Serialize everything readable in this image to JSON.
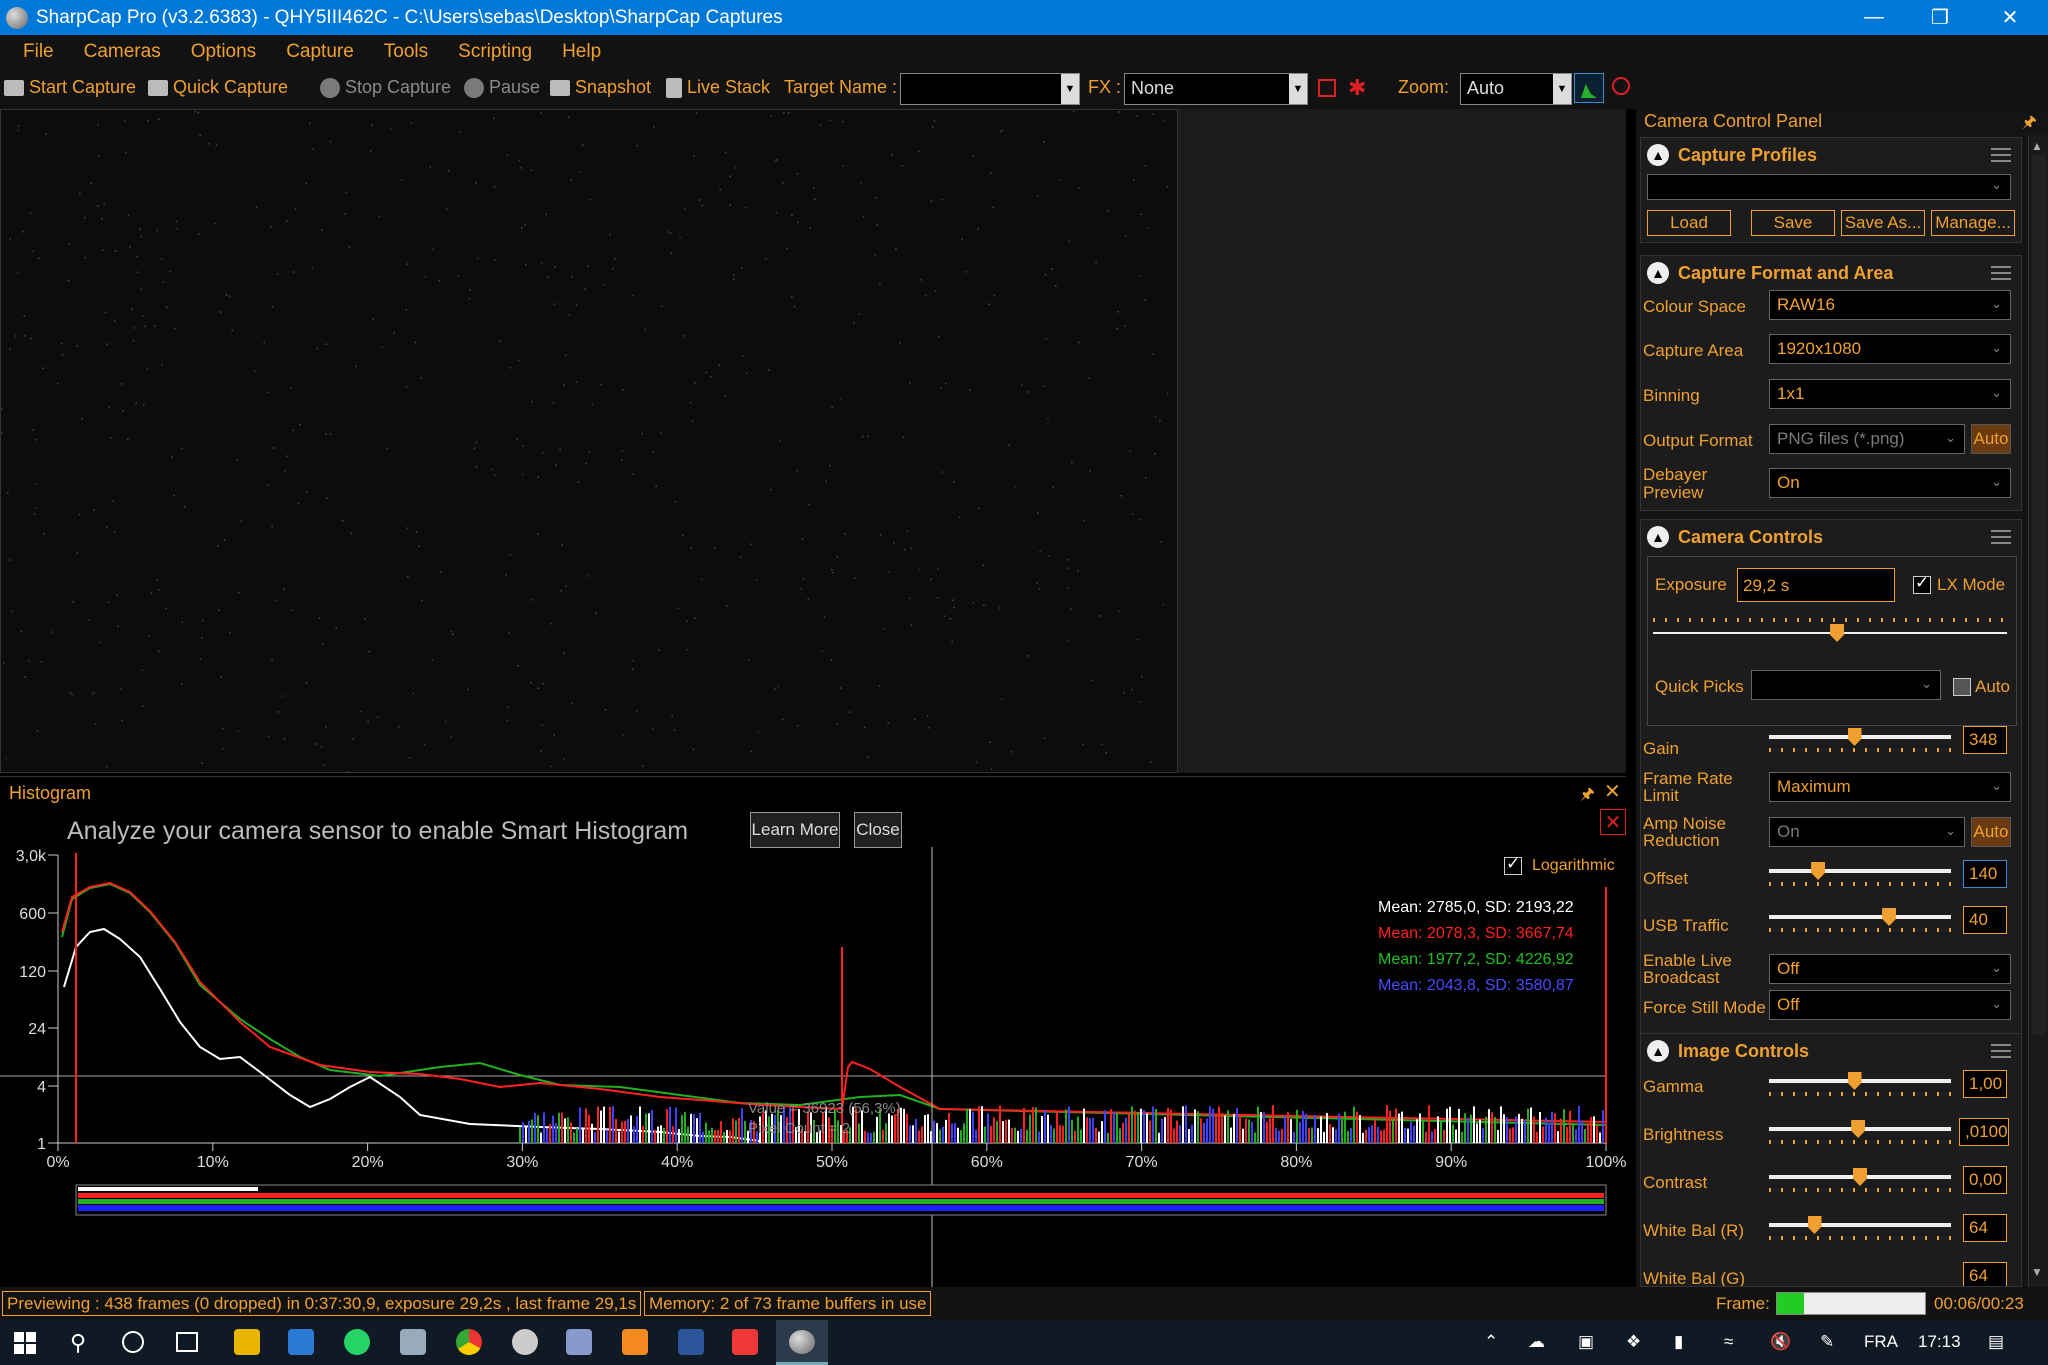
{
  "window": {
    "title": "SharpCap Pro (v3.2.6383) - QHY5III462C - C:\\Users\\sebas\\Desktop\\SharpCap Captures"
  },
  "menu": [
    "File",
    "Cameras",
    "Options",
    "Capture",
    "Tools",
    "Scripting",
    "Help"
  ],
  "toolbar": {
    "start_capture": "Start Capture",
    "quick_capture": "Quick Capture",
    "stop_capture": "Stop Capture",
    "pause": "Pause",
    "snapshot": "Snapshot",
    "live_stack": "Live Stack",
    "target_name_label": "Target Name :",
    "target_name_value": "",
    "fx_label": "FX :",
    "fx_value": "None",
    "zoom_label": "Zoom:",
    "zoom_value": "Auto"
  },
  "histogram": {
    "title": "Histogram",
    "banner": "Analyze your camera sensor to enable Smart Histogram",
    "learn_more": "Learn More",
    "close": "Close",
    "logarithmic_label": "Logarithmic",
    "logarithmic_checked": true,
    "stats": [
      {
        "text": "Mean: 2785,0, SD: 2193,22",
        "color": "#ffffff"
      },
      {
        "text": "Mean: 2078,3, SD: 3667,74",
        "color": "#ff2020"
      },
      {
        "text": "Mean: 1977,2, SD: 4226,92",
        "color": "#20c020"
      },
      {
        "text": "Mean: 2043,8, SD: 3580,87",
        "color": "#4040ff"
      }
    ],
    "cursor_value": "Value = 36923 (56,3%)",
    "cursor_pixel_count": "Pixel Count = 2",
    "y_ticks": [
      "3,0k",
      "600",
      "120",
      "24",
      "4",
      "1"
    ],
    "x_ticks": [
      "0%",
      "10%",
      "20%",
      "30%",
      "40%",
      "50%",
      "60%",
      "70%",
      "80%",
      "90%",
      "100%"
    ]
  },
  "status": {
    "previewing": "Previewing : 438 frames (0 dropped) in 0:37:30,9, exposure 29,2s , last frame 29,1s",
    "memory": "Memory: 2 of 73 frame buffers in use",
    "frame_label": "Frame:",
    "frame_time": "00:06/00:23",
    "frame_progress": 0.18
  },
  "panel": {
    "title": "Camera Control Panel",
    "capture_profiles": {
      "header": "Capture Profiles",
      "profile_value": "",
      "load": "Load",
      "save": "Save",
      "save_as": "Save As...",
      "manage": "Manage..."
    },
    "format": {
      "header": "Capture Format and Area",
      "colour_space_label": "Colour Space",
      "colour_space": "RAW16",
      "capture_area_label": "Capture Area",
      "capture_area": "1920x1080",
      "binning_label": "Binning",
      "binning": "1x1",
      "output_format_label": "Output Format",
      "output_format": "PNG files (*.png)",
      "auto": "Auto",
      "debayer_label_1": "Debayer",
      "debayer_label_2": "Preview",
      "debayer": "On"
    },
    "camera_controls": {
      "header": "Camera Controls",
      "exposure_label": "Exposure",
      "exposure": "29,2 s",
      "lx_mode_label": "LX Mode",
      "lx_mode": true,
      "exposure_level": 0.52,
      "quick_picks_label": "Quick Picks",
      "quick_picks_value": "",
      "quick_picks_auto": "Auto",
      "gain_label": "Gain",
      "gain": "348",
      "gain_level": 0.47,
      "frame_rate_label_1": "Frame Rate",
      "frame_rate_label_2": "Limit",
      "frame_rate": "Maximum",
      "amp_noise_label_1": "Amp Noise",
      "amp_noise_label_2": "Reduction",
      "amp_noise": "On",
      "amp_auto": "Auto",
      "offset_label": "Offset",
      "offset": "140",
      "offset_level": 0.27,
      "usb_label": "USB Traffic",
      "usb": "40",
      "usb_level": 0.66,
      "live_broadcast_label_1": "Enable Live",
      "live_broadcast_label_2": "Broadcast",
      "live_broadcast": "Off",
      "force_still_label": "Force Still Mode",
      "force_still": "Off"
    },
    "image_controls": {
      "header": "Image Controls",
      "gamma_label": "Gamma",
      "gamma": "1,00",
      "gamma_level": 0.47,
      "brightness_label": "Brightness",
      "brightness": ",0100",
      "brightness_level": 0.49,
      "contrast_label": "Contrast",
      "contrast": "0,00",
      "contrast_level": 0.5,
      "wb_r_label": "White Bal (R)",
      "wb_r": "64",
      "wb_r_level": 0.25,
      "wb_g_label": "White Bal (G)",
      "wb_g": "64"
    }
  },
  "taskbar": {
    "language": "FRA",
    "time": "17:13"
  },
  "colors": {
    "accent": "#f0a030",
    "titlebar": "#0078d7"
  }
}
